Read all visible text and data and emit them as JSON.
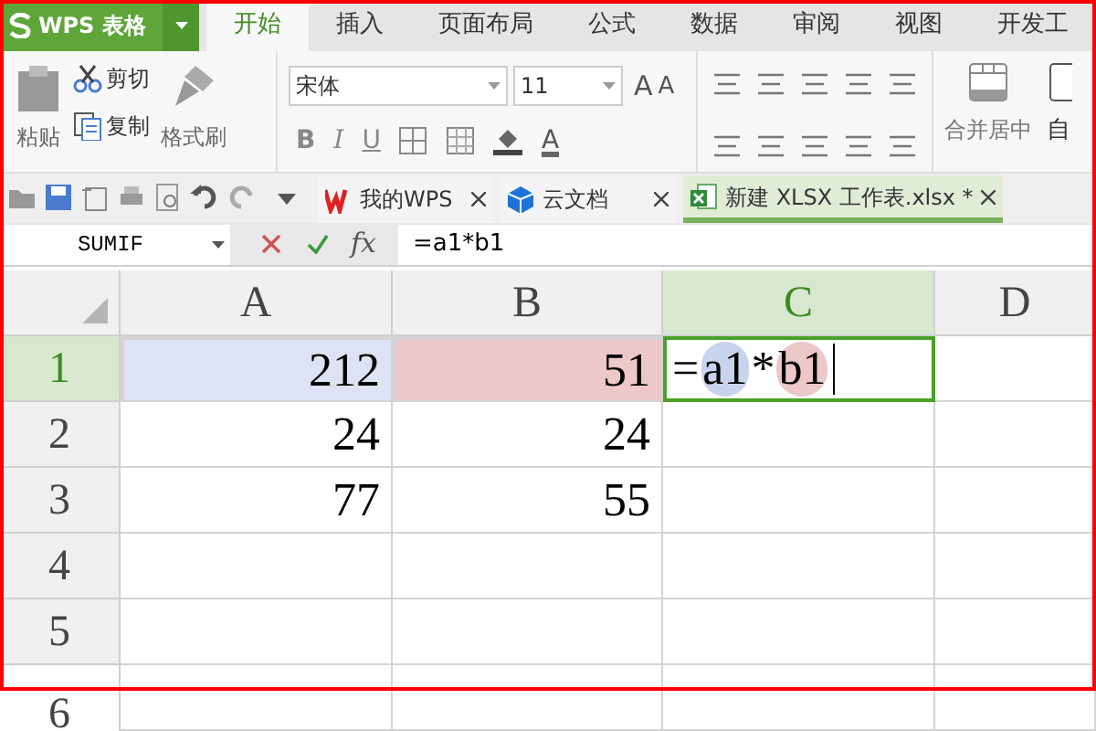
{
  "app_menu": {
    "label": "WPS 表格"
  },
  "ribbon_tabs": [
    {
      "label": "开始",
      "selected": true
    },
    {
      "label": "插入",
      "selected": false
    },
    {
      "label": "页面布局",
      "selected": false
    },
    {
      "label": "公式",
      "selected": false
    },
    {
      "label": "数据",
      "selected": false
    },
    {
      "label": "审阅",
      "selected": false
    },
    {
      "label": "视图",
      "selected": false
    },
    {
      "label": "开发工",
      "selected": false
    }
  ],
  "clipboard": {
    "paste": "粘贴",
    "cut": "剪切",
    "copy": "复制",
    "format_painter": "格式刷"
  },
  "font": {
    "name": "宋体",
    "size": "11",
    "style_buttons": [
      "B",
      "I",
      "U"
    ],
    "grow": "A",
    "shrink": "A",
    "color_button": "A"
  },
  "merge": {
    "label": "合并居中"
  },
  "wrap": {
    "label": "自"
  },
  "doc_tabs": [
    {
      "kind": "wps",
      "label": "我的WPS",
      "selected": false
    },
    {
      "kind": "cloud",
      "label": "云文档",
      "selected": false
    },
    {
      "kind": "sheet",
      "label": "新建 XLSX 工作表.xlsx *",
      "selected": true
    }
  ],
  "formula_bar": {
    "name_box": "SUMIF",
    "fx": "fx",
    "formula": "=a1*b1"
  },
  "columns": [
    {
      "label": "A",
      "selected": false
    },
    {
      "label": "B",
      "selected": false
    },
    {
      "label": "C",
      "selected": true
    },
    {
      "label": "D",
      "selected": false
    }
  ],
  "rows": [
    {
      "label": "1",
      "selected": true,
      "cells": [
        {
          "value": "212",
          "color": "#dde3f4"
        },
        {
          "value": "51",
          "color": "#ecc8c8"
        },
        {
          "kind": "editing",
          "tokens": [
            {
              "text": "="
            },
            {
              "text": "a1",
              "color": "#c8d4ee"
            },
            {
              "text": "*"
            },
            {
              "text": "b1",
              "color": "#ecc8c8"
            }
          ]
        }
      ]
    },
    {
      "label": "2",
      "selected": false,
      "cells": [
        {
          "value": "24"
        },
        {
          "value": "24"
        }
      ]
    },
    {
      "label": "3",
      "selected": false,
      "cells": [
        {
          "value": "77"
        },
        {
          "value": "55"
        }
      ]
    },
    {
      "label": "4",
      "selected": false,
      "cells": []
    },
    {
      "label": "5",
      "selected": false,
      "cells": []
    },
    {
      "label": "6",
      "selected": false,
      "cells": []
    }
  ]
}
